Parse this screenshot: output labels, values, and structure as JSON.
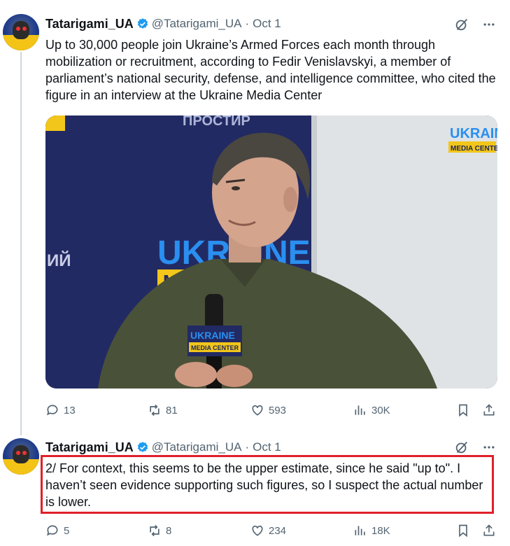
{
  "tweets": [
    {
      "author_name": "Tatarigami_UA",
      "handle": "@Tatarigami_UA",
      "separator": "·",
      "date": "Oct 1",
      "text": "Up to 30,000 people join Ukraine’s Armed Forces each month through mobilization or recruitment, according to Fedir Venislavskyi, a member of parliament’s national security, defense, and intelligence committee, who cited the figure in an interview at the Ukraine Media Center",
      "replies": "13",
      "reposts": "81",
      "likes": "593",
      "views": "30K",
      "media": {
        "sign_top": "ПРОСТИР",
        "sign_left": "ИЙ",
        "sign_ukraine": "UKRAINE",
        "sign_media_partial": "M",
        "logo_line1": "UKRAINE",
        "logo_line2": "MEDIA CENTER",
        "mic_line1": "UKRAINE",
        "mic_line2": "MEDIA CENTER"
      }
    },
    {
      "author_name": "Tatarigami_UA",
      "handle": "@Tatarigami_UA",
      "separator": "·",
      "date": "Oct 1",
      "text": "2/ For context, this seems to be the upper estimate, since he said \"up to\". I haven’t seen evidence supporting such figures, so I suspect the actual number is lower.",
      "replies": "5",
      "reposts": "8",
      "likes": "234",
      "views": "18K"
    }
  ],
  "colors": {
    "accent": "#1d9bf0",
    "secondary_text": "#536471",
    "highlight": "#e0202a"
  },
  "icons": [
    "verified-badge-icon",
    "grok-icon",
    "more-icon",
    "reply-icon",
    "repost-icon",
    "like-icon",
    "views-icon",
    "bookmark-icon",
    "share-icon"
  ]
}
